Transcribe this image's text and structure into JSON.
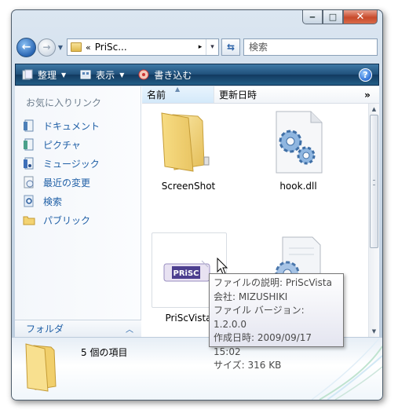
{
  "window": {
    "minimize": "‒",
    "maximize": "□",
    "close": "✕"
  },
  "address": {
    "chevron": "«",
    "crumb": "PriSc...",
    "crumb_arrow": "▸",
    "dropdown": "▾",
    "search_placeholder": "検索"
  },
  "commands": {
    "organize": "整理",
    "views": "表示",
    "burn": "書き込む",
    "help": "?"
  },
  "sidebar": {
    "favorites_title": "お気に入りリンク",
    "items": [
      {
        "label": "ドキュメント",
        "icon": "documents-icon"
      },
      {
        "label": "ピクチャ",
        "icon": "pictures-icon"
      },
      {
        "label": "ミュージック",
        "icon": "music-icon"
      },
      {
        "label": "最近の変更",
        "icon": "recent-icon"
      },
      {
        "label": "検索",
        "icon": "search-icon"
      },
      {
        "label": "パブリック",
        "icon": "public-folder-icon"
      }
    ],
    "folders_label": "フォルダ",
    "folders_chevron": "︿"
  },
  "columns": {
    "name": "名前",
    "sort_arrow": "▲",
    "date": "更新日時",
    "more": "»"
  },
  "files": [
    {
      "name": "ScreenShot",
      "icon": "folder-icon"
    },
    {
      "name": "hook.dll",
      "icon": "dll-file-icon"
    },
    {
      "name": "PriScVista",
      "icon": "priscvista-app-icon"
    },
    {
      "name": "",
      "icon": "settings-file-icon"
    }
  ],
  "tooltip": {
    "description": "ファイルの説明: PriScVista",
    "company": "会社: MIZUSHIKI",
    "version": "ファイル バージョン: 1.2.0.0",
    "created": "作成日時: 2009/09/17 15:02",
    "size": "サイズ: 316 KB"
  },
  "details": {
    "count": "5 個の項目"
  },
  "colors": {
    "link": "#1f5fa6",
    "command_bar": "#1f4f7a",
    "close": "#c84a2b"
  }
}
